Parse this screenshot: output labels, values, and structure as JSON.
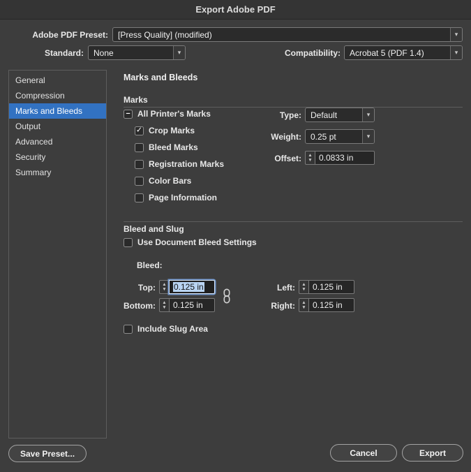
{
  "dialog": {
    "title": "Export Adobe PDF",
    "preset": {
      "label": "Adobe PDF Preset:",
      "value": "[Press Quality] (modified)"
    },
    "standard": {
      "label": "Standard:",
      "value": "None"
    },
    "compatibility": {
      "label": "Compatibility:",
      "value": "Acrobat 5 (PDF 1.4)"
    }
  },
  "sidebar": {
    "items": [
      {
        "label": "General",
        "selected": false
      },
      {
        "label": "Compression",
        "selected": false
      },
      {
        "label": "Marks and Bleeds",
        "selected": true
      },
      {
        "label": "Output",
        "selected": false
      },
      {
        "label": "Advanced",
        "selected": false
      },
      {
        "label": "Security",
        "selected": false
      },
      {
        "label": "Summary",
        "selected": false
      }
    ]
  },
  "panel": {
    "title": "Marks and Bleeds",
    "marks": {
      "section_title": "Marks",
      "all_printers_marks": {
        "label": "All Printer's Marks",
        "state": "mixed"
      },
      "checkboxes": [
        {
          "label": "Crop Marks",
          "checked": true
        },
        {
          "label": "Bleed Marks",
          "checked": false
        },
        {
          "label": "Registration Marks",
          "checked": false
        },
        {
          "label": "Color Bars",
          "checked": false
        },
        {
          "label": "Page Information",
          "checked": false
        }
      ],
      "type": {
        "label": "Type:",
        "value": "Default"
      },
      "weight": {
        "label": "Weight:",
        "value": "0.25 pt"
      },
      "offset": {
        "label": "Offset:",
        "value": "0.0833 in"
      }
    },
    "bleed_slug": {
      "section_title": "Bleed and Slug",
      "use_doc_bleed": {
        "label": "Use Document Bleed Settings",
        "checked": false
      },
      "bleed_label": "Bleed:",
      "top": {
        "label": "Top:",
        "value": "0.125 in",
        "focused": true
      },
      "bottom": {
        "label": "Bottom:",
        "value": "0.125 in"
      },
      "left": {
        "label": "Left:",
        "value": "0.125 in"
      },
      "right": {
        "label": "Right:",
        "value": "0.125 in"
      },
      "link_icon": "link-bleed-values-icon",
      "include_slug": {
        "label": "Include Slug Area",
        "checked": false
      }
    }
  },
  "footer": {
    "save_preset": "Save Preset...",
    "cancel": "Cancel",
    "export": "Export"
  },
  "colors": {
    "accent_blue": "#3272c2",
    "dialog_bg": "#3d3d3d",
    "field_bg": "#262626",
    "selection_bg": "#b9d4f2"
  }
}
